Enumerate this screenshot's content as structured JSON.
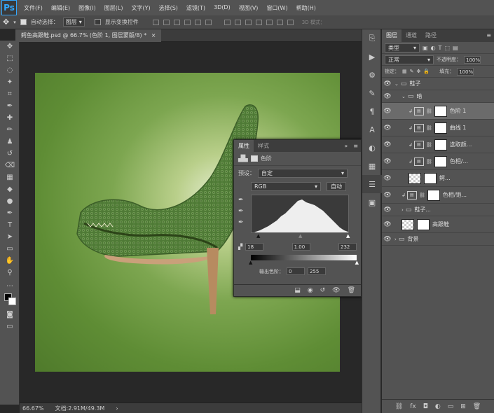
{
  "app": {
    "logo": "Ps"
  },
  "menu": [
    "文件(F)",
    "编辑(E)",
    "图像(I)",
    "图层(L)",
    "文字(Y)",
    "选择(S)",
    "滤镜(T)",
    "3D(D)",
    "视图(V)",
    "窗口(W)",
    "帮助(H)"
  ],
  "options": {
    "auto_select_label": "自动选择：",
    "auto_select_value": "图层",
    "show_transform_label": "显示变换控件",
    "mode_3d": "3D 模式："
  },
  "document": {
    "tab_title": "鳄鱼高跟鞋.psd @ 66.7% (色阶 1, 图层蒙版/8) *",
    "close": "×"
  },
  "status": {
    "zoom": "66.67%",
    "doc_size": "文档:2.91M/49.3M"
  },
  "layers_panel": {
    "tabs": [
      "图层",
      "通道",
      "路径"
    ],
    "filter_kind": "类型",
    "blend_mode": "正常",
    "opacity_label": "不透明度：",
    "opacity_value": "100%",
    "lock_label": "锁定：",
    "fill_label": "填充：",
    "fill_value": "100%",
    "layers": [
      {
        "name": "鞋子",
        "type": "group",
        "indent": 0
      },
      {
        "name": "暗",
        "type": "group",
        "indent": 1
      },
      {
        "name": "色阶 1",
        "type": "levels",
        "indent": 2,
        "selected": true
      },
      {
        "name": "曲线 1",
        "type": "curves",
        "indent": 2
      },
      {
        "name": "选取颜...",
        "type": "selcolor",
        "indent": 2
      },
      {
        "name": "色相/...",
        "type": "huesat",
        "indent": 2
      },
      {
        "name": "鳄...",
        "type": "image",
        "indent": 2
      },
      {
        "name": "色相/饱...",
        "type": "huesat",
        "indent": 1
      },
      {
        "name": "鞋子...",
        "type": "group",
        "indent": 1
      },
      {
        "name": "高跟鞋",
        "type": "image",
        "indent": 1
      },
      {
        "name": "背景",
        "type": "group",
        "indent": 0
      }
    ]
  },
  "properties_panel": {
    "tabs": [
      "属性",
      "样式"
    ],
    "title": "色阶",
    "preset_label": "预设：",
    "preset_value": "自定",
    "channel": "RGB",
    "auto_label": "自动",
    "input_black": "18",
    "input_gamma": "1.00",
    "input_white": "232",
    "output_label": "输出色阶：",
    "output_black": "0",
    "output_white": "255"
  }
}
